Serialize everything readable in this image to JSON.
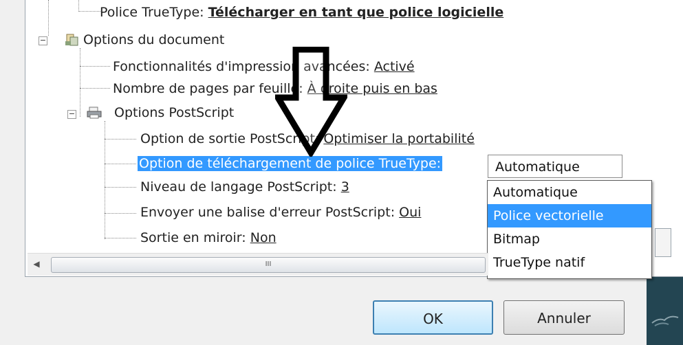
{
  "tree": {
    "row0": {
      "label": "Police TrueType: ",
      "value": "Télécharger en tant que police logicielle"
    },
    "row1": {
      "label": "Options du document"
    },
    "row2": {
      "label": "Fonctionnalités d'impression avancées: ",
      "value": "Activé"
    },
    "row3": {
      "label": "Nombre de pages par feuille: ",
      "value": "À droite puis en bas"
    },
    "row4": {
      "label": "Options PostScript"
    },
    "row5": {
      "label": "Option de sortie PostScript: ",
      "value": "Optimiser la portabilité"
    },
    "row6": {
      "label": "Option de téléchargement de police TrueType:"
    },
    "row7": {
      "label": "Niveau de langage PostScript: ",
      "value": "3"
    },
    "row8": {
      "label": "Envoyer une balise d'erreur PostScript: ",
      "value": "Oui"
    },
    "row9": {
      "label": "Sortie en miroir: ",
      "value": "Non"
    }
  },
  "combo": {
    "value": "Automatique"
  },
  "dropdown": {
    "options": [
      "Automatique",
      "Police vectorielle",
      "Bitmap",
      "TrueType natif"
    ],
    "selected_index": 1
  },
  "scrollbar": {
    "thumb_grip": "III"
  },
  "buttons": {
    "ok": "OK",
    "cancel": "Annuler"
  },
  "colors": {
    "highlight": "#3399ff",
    "dialog_bg": "#f0f0f0"
  }
}
